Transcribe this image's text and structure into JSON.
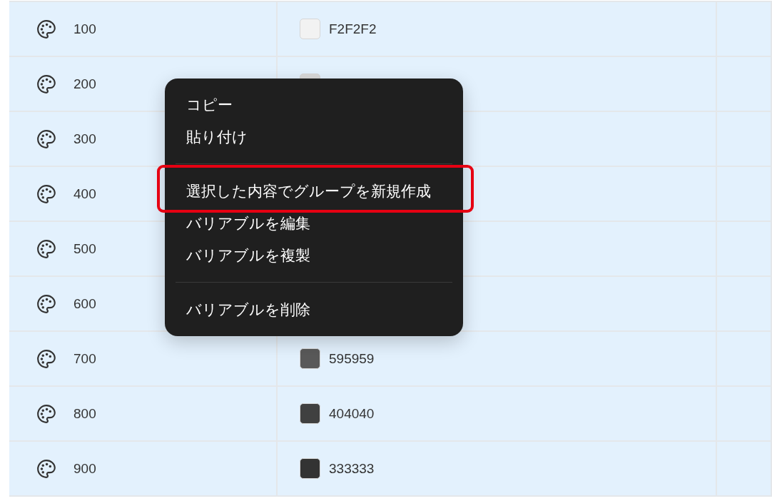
{
  "table": {
    "rows": [
      {
        "name": "100",
        "selected": true,
        "color": "#f2f2f2",
        "value": "F2F2F2"
      },
      {
        "name": "200",
        "selected": true,
        "color": "#d9d9d9"
      },
      {
        "name": "300",
        "selected": true
      },
      {
        "name": "400",
        "selected": true
      },
      {
        "name": "500",
        "selected": true
      },
      {
        "name": "600",
        "selected": true
      },
      {
        "name": "700",
        "selected": true,
        "color": "#595959",
        "value": "595959"
      },
      {
        "name": "800",
        "selected": true,
        "color": "#404040",
        "value": "404040"
      },
      {
        "name": "900",
        "selected": true,
        "color": "#333333",
        "value": "333333"
      }
    ]
  },
  "context_menu": {
    "groups": [
      {
        "items": [
          {
            "label": "コピー",
            "highlighted": false
          },
          {
            "label": "貼り付け",
            "highlighted": false
          }
        ]
      },
      {
        "items": [
          {
            "label": "選択した内容でグループを新規作成",
            "highlighted": true
          },
          {
            "label": "バリアブルを編集",
            "highlighted": false
          },
          {
            "label": "バリアブルを複製",
            "highlighted": false
          }
        ]
      },
      {
        "items": [
          {
            "label": "バリアブルを削除",
            "highlighted": false
          }
        ]
      }
    ]
  }
}
